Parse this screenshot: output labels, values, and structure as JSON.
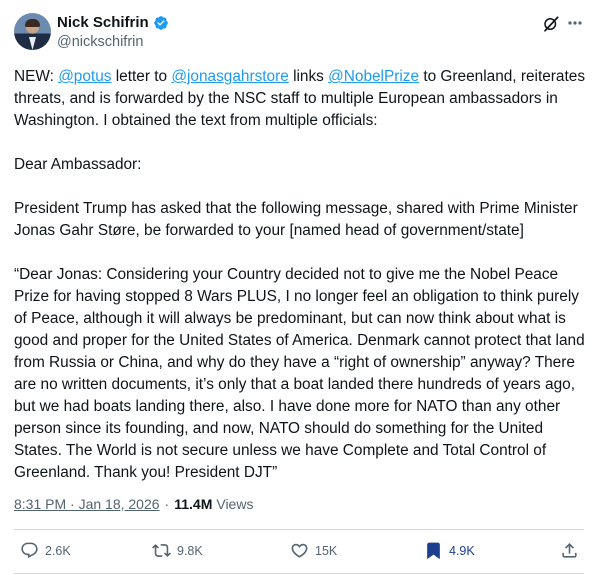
{
  "author": {
    "name": "Nick Schifrin",
    "handle": "@nickschifrin"
  },
  "tweet": {
    "intro_prefix": "NEW: ",
    "mention_1": "@potus",
    "intro_mid_1": " letter to ",
    "mention_2": "@jonasgahrstore",
    "intro_mid_2": " links ",
    "mention_3": "@NobelPrize",
    "intro_suffix": " to Greenland, reiterates threats, and is forwarded by the NSC staff to multiple European ambassadors in Washington. I obtained the text from multiple officials:",
    "salutation": "Dear Ambassador:",
    "paragraph_2": "President Trump has asked that the following message, shared with Prime Minister Jonas Gahr Støre, be forwarded to your [named head of government/state]",
    "paragraph_3": "“Dear Jonas: Considering your Country decided not to give me the Nobel Peace Prize for having stopped 8 Wars PLUS, I no longer feel an obligation to think purely of Peace, although it will always be predominant, but can now think about what is good and proper for the United States of America. Denmark cannot protect that land from Russia or China, and why do they have a “right of ownership” anyway? There are no written documents, it’s only that a boat landed there hundreds of years ago, but we had boats landing there, also. I have done more for NATO than any other person since its founding, and now, NATO should do something for the United States. The World is not secure unless we have Complete and Total Control of Greenland. Thank you! President DJT”"
  },
  "meta": {
    "time": "8:31 PM · Jan 18, 2026",
    "separator": "·",
    "views_count": "11.4M",
    "views_label": "Views"
  },
  "actions": {
    "replies": "2.6K",
    "reposts": "9.8K",
    "likes": "15K",
    "bookmarks": "4.9K"
  },
  "colors": {
    "link": "#1d9bf0",
    "secondary_text": "#536471",
    "bookmark_active": "#1a3f8f",
    "verified": "#1d9bf0"
  },
  "icons": [
    "verified-badge-icon",
    "grok-icon",
    "more-icon",
    "reply-icon",
    "repost-icon",
    "like-icon",
    "bookmark-icon",
    "share-icon"
  ]
}
